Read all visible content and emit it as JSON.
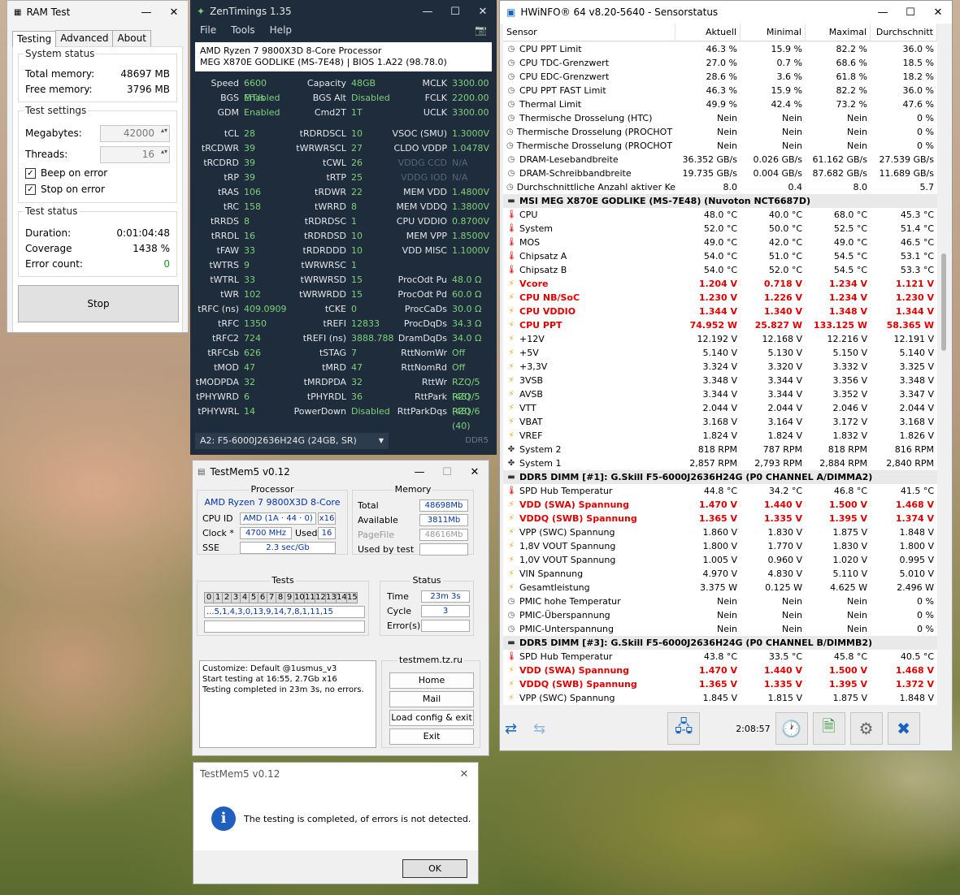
{
  "ramtest": {
    "title": "RAM Test",
    "tabs": [
      "Testing",
      "Advanced",
      "About"
    ],
    "system_status": {
      "label": "System status",
      "total_label": "Total memory:",
      "total": "48697 MB",
      "free_label": "Free memory:",
      "free": "3796 MB"
    },
    "settings": {
      "label": "Test settings",
      "mb_label": "Megabytes:",
      "mb": "42000",
      "threads_label": "Threads:",
      "threads": "16",
      "beep": "Beep on error",
      "stop": "Stop on error"
    },
    "test_status": {
      "label": "Test status",
      "duration_label": "Duration:",
      "duration": "0:01:04:48",
      "coverage_label": "Coverage",
      "coverage": "1438 %",
      "errors_label": "Error count:",
      "errors": "0"
    },
    "stop_button": "Stop"
  },
  "zen": {
    "title": "ZenTimings 1.35",
    "menu": [
      "File",
      "Tools",
      "Help"
    ],
    "cpu": "AMD Ryzen 7 9800X3D 8-Core Processor",
    "board": "MEG X870E GODLIKE (MS-7E48) | BIOS 1.A22 (98.78.0)",
    "header": [
      [
        "Speed",
        "6600 MT/s",
        "Capacity",
        "48GB",
        "MCLK",
        "3300.00"
      ],
      [
        "BGS",
        "Enabled",
        "BGS Alt",
        "Disabled",
        "FCLK",
        "2200.00"
      ],
      [
        "GDM",
        "Enabled",
        "Cmd2T",
        "1T",
        "UCLK",
        "3300.00"
      ]
    ],
    "timings": [
      [
        "tCL",
        "28",
        "tRDRDSCL",
        "10",
        "VSOC (SMU)",
        "1.3000V"
      ],
      [
        "tRCDWR",
        "39",
        "tWRWRSCL",
        "27",
        "CLDO VDDP",
        "1.0478V"
      ],
      [
        "tRCDRD",
        "39",
        "tCWL",
        "26",
        "VDDG CCD",
        "N/A"
      ],
      [
        "tRP",
        "39",
        "tRTP",
        "25",
        "VDDG IOD",
        "N/A"
      ],
      [
        "tRAS",
        "106",
        "tRDWR",
        "22",
        "MEM VDD",
        "1.4800V"
      ],
      [
        "tRC",
        "158",
        "tWRRD",
        "8",
        "MEM VDDQ",
        "1.3800V"
      ],
      [
        "tRRDS",
        "8",
        "tRDRDSC",
        "1",
        "CPU VDDIO",
        "0.8700V"
      ],
      [
        "tRRDL",
        "16",
        "tRDRDSD",
        "10",
        "MEM VPP",
        "1.8500V"
      ],
      [
        "tFAW",
        "33",
        "tRDRDDD",
        "10",
        "VDD MISC",
        "1.1000V"
      ],
      [
        "tWTRS",
        "9",
        "tWRWRSC",
        "1",
        "",
        ""
      ],
      [
        "tWTRL",
        "33",
        "tWRWRSD",
        "15",
        "ProcOdt Pu",
        "48.0 Ω"
      ],
      [
        "tWR",
        "102",
        "tWRWRDD",
        "15",
        "ProcOdt Pd",
        "60.0 Ω"
      ],
      [
        "tRFC (ns)",
        "409.0909",
        "tCKE",
        "0",
        "ProcCaDs",
        "30.0 Ω"
      ],
      [
        "tRFC",
        "1350",
        "tREFI",
        "12833",
        "ProcDqDs",
        "34.3 Ω"
      ],
      [
        "tRFC2",
        "724",
        "tREFI (ns)",
        "3888.788",
        "DramDqDs",
        "34.0 Ω"
      ],
      [
        "tRFCsb",
        "626",
        "tSTAG",
        "7",
        "RttNomWr",
        "Off"
      ],
      [
        "tMOD",
        "47",
        "tMRD",
        "47",
        "RttNomRd",
        "Off"
      ],
      [
        "tMODPDA",
        "32",
        "tMRDPDA",
        "32",
        "RttWr",
        "RZQ/5 (48)"
      ],
      [
        "tPHYWRD",
        "6",
        "tPHYRDL",
        "36",
        "RttPark",
        "RZQ/5 (48)"
      ],
      [
        "tPHYWRL",
        "14",
        "PowerDown",
        "Disabled",
        "RttParkDqs",
        "RZQ/6 (40)"
      ]
    ],
    "dimm": "A2: F5-6000J2636H24G (24GB, SR)",
    "ddr": "DDR5"
  },
  "hw": {
    "title": "HWiNFO® 64 v8.20-5640 - Sensorstatus",
    "cols": [
      "Sensor",
      "Aktuell",
      "Minimal",
      "Maximal",
      "Durchschnitt"
    ],
    "rows": [
      [
        "clk",
        "CPU PPT Limit",
        "46.3 %",
        "15.9 %",
        "82.2 %",
        "36.0 %",
        ""
      ],
      [
        "clk",
        "CPU TDC-Grenzwert",
        "27.0 %",
        "0.7 %",
        "68.6 %",
        "18.5 %",
        ""
      ],
      [
        "clk",
        "CPU EDC-Grenzwert",
        "28.6 %",
        "3.6 %",
        "61.8 %",
        "18.2 %",
        ""
      ],
      [
        "clk",
        "CPU PPT FAST Limit",
        "46.3 %",
        "15.9 %",
        "82.2 %",
        "36.0 %",
        ""
      ],
      [
        "clk",
        "Thermal Limit",
        "49.9 %",
        "42.4 %",
        "73.2 %",
        "47.6 %",
        ""
      ],
      [
        "clk",
        "Thermische Drosselung (HTC)",
        "Nein",
        "Nein",
        "Nein",
        "0 %",
        ""
      ],
      [
        "clk",
        "Thermische Drosselung (PROCHOT C...",
        "Nein",
        "Nein",
        "Nein",
        "0 %",
        ""
      ],
      [
        "clk",
        "Thermische Drosselung (PROCHOT EXT)",
        "Nein",
        "Nein",
        "Nein",
        "0 %",
        ""
      ],
      [
        "clk",
        "DRAM-Lesebandbreite",
        "36.352 GB/s",
        "0.026 GB/s",
        "61.162 GB/s",
        "27.539 GB/s",
        ""
      ],
      [
        "clk",
        "DRAM-Schreibbandbreite",
        "19.735 GB/s",
        "0.004 GB/s",
        "87.682 GB/s",
        "11.689 GB/s",
        ""
      ],
      [
        "clk",
        "Durchschnittliche Anzahl aktiver Kerne",
        "8.0",
        "0.4",
        "8.0",
        "5.7",
        ""
      ],
      [
        "chip",
        "MSI MEG X870E GODLIKE (MS-7E48) (Nuvoton NCT6687D)",
        "",
        "",
        "",
        "",
        "sec"
      ],
      [
        "th",
        "CPU",
        "48.0 °C",
        "40.0 °C",
        "68.0 °C",
        "45.3 °C",
        ""
      ],
      [
        "th",
        "System",
        "52.0 °C",
        "50.0 °C",
        "52.5 °C",
        "51.4 °C",
        ""
      ],
      [
        "th",
        "MOS",
        "49.0 °C",
        "42.0 °C",
        "49.0 °C",
        "46.5 °C",
        ""
      ],
      [
        "th",
        "Chipsatz A",
        "54.0 °C",
        "51.0 °C",
        "54.5 °C",
        "53.1 °C",
        ""
      ],
      [
        "th",
        "Chipsatz B",
        "54.0 °C",
        "52.0 °C",
        "54.5 °C",
        "53.3 °C",
        ""
      ],
      [
        "bolt",
        "Vcore",
        "1.204 V",
        "0.718 V",
        "1.234 V",
        "1.121 V",
        "red"
      ],
      [
        "bolt",
        "CPU NB/SoC",
        "1.230 V",
        "1.226 V",
        "1.234 V",
        "1.230 V",
        "red"
      ],
      [
        "bolt",
        "CPU VDDIO",
        "1.344 V",
        "1.340 V",
        "1.348 V",
        "1.344 V",
        "red"
      ],
      [
        "bolt",
        "CPU PPT",
        "74.952 W",
        "25.827 W",
        "133.125 W",
        "58.365 W",
        "red"
      ],
      [
        "bolt",
        "+12V",
        "12.192 V",
        "12.168 V",
        "12.216 V",
        "12.191 V",
        ""
      ],
      [
        "bolt",
        "+5V",
        "5.140 V",
        "5.130 V",
        "5.150 V",
        "5.140 V",
        ""
      ],
      [
        "bolt",
        "+3,3V",
        "3.324 V",
        "3.320 V",
        "3.332 V",
        "3.325 V",
        ""
      ],
      [
        "bolt",
        "3VSB",
        "3.348 V",
        "3.344 V",
        "3.356 V",
        "3.348 V",
        ""
      ],
      [
        "bolt",
        "AVSB",
        "3.344 V",
        "3.344 V",
        "3.352 V",
        "3.347 V",
        ""
      ],
      [
        "bolt",
        "VTT",
        "2.044 V",
        "2.044 V",
        "2.046 V",
        "2.044 V",
        ""
      ],
      [
        "bolt",
        "VBAT",
        "3.168 V",
        "3.164 V",
        "3.172 V",
        "3.168 V",
        ""
      ],
      [
        "bolt",
        "VREF",
        "1.824 V",
        "1.824 V",
        "1.832 V",
        "1.826 V",
        ""
      ],
      [
        "fan",
        "System 2",
        "818 RPM",
        "787 RPM",
        "818 RPM",
        "816 RPM",
        ""
      ],
      [
        "fan",
        "System 1",
        "2,857 RPM",
        "2,793 RPM",
        "2,884 RPM",
        "2,840 RPM",
        ""
      ],
      [
        "chip",
        "DDR5 DIMM [#1]: G.Skill F5-6000J2636H24G (P0 CHANNEL A/DIMMA2)",
        "",
        "",
        "",
        "",
        "sec"
      ],
      [
        "th",
        "SPD Hub Temperatur",
        "44.8 °C",
        "34.2 °C",
        "46.8 °C",
        "41.5 °C",
        ""
      ],
      [
        "bolt",
        "VDD (SWA) Spannung",
        "1.470 V",
        "1.440 V",
        "1.500 V",
        "1.468 V",
        "red"
      ],
      [
        "bolt",
        "VDDQ (SWB) Spannung",
        "1.365 V",
        "1.335 V",
        "1.395 V",
        "1.374 V",
        "red"
      ],
      [
        "bolt",
        "VPP (SWC) Spannung",
        "1.860 V",
        "1.830 V",
        "1.875 V",
        "1.848 V",
        ""
      ],
      [
        "bolt",
        "1,8V VOUT Spannung",
        "1.800 V",
        "1.770 V",
        "1.830 V",
        "1.800 V",
        ""
      ],
      [
        "bolt",
        "1,0V VOUT Spannung",
        "1.005 V",
        "0.960 V",
        "1.020 V",
        "0.995 V",
        ""
      ],
      [
        "bolt",
        "VIN Spannung",
        "4.970 V",
        "4.830 V",
        "5.110 V",
        "5.010 V",
        ""
      ],
      [
        "bolt",
        "Gesamtleistung",
        "3.375 W",
        "0.125 W",
        "4.625 W",
        "2.496 W",
        ""
      ],
      [
        "clk",
        "PMIC hohe Temperatur",
        "Nein",
        "Nein",
        "Nein",
        "0 %",
        ""
      ],
      [
        "clk",
        "PMIC-Überspannung",
        "Nein",
        "Nein",
        "Nein",
        "0 %",
        ""
      ],
      [
        "clk",
        "PMIC-Unterspannung",
        "Nein",
        "Nein",
        "Nein",
        "0 %",
        ""
      ],
      [
        "chip",
        "DDR5 DIMM [#3]: G.Skill F5-6000J2636H24G (P0 CHANNEL B/DIMMB2)",
        "",
        "",
        "",
        "",
        "sec"
      ],
      [
        "th",
        "SPD Hub Temperatur",
        "43.8 °C",
        "33.5 °C",
        "45.8 °C",
        "40.5 °C",
        ""
      ],
      [
        "bolt",
        "VDD (SWA) Spannung",
        "1.470 V",
        "1.440 V",
        "1.500 V",
        "1.468 V",
        "red"
      ],
      [
        "bolt",
        "VDDQ (SWB) Spannung",
        "1.365 V",
        "1.335 V",
        "1.395 V",
        "1.372 V",
        "red"
      ],
      [
        "bolt",
        "VPP (SWC) Spannung",
        "1.845 V",
        "1.815 V",
        "1.875 V",
        "1.848 V",
        ""
      ]
    ],
    "clock": "2:08:57"
  },
  "tm": {
    "title": "TestMem5 v0.12",
    "proc": {
      "label": "Processor",
      "name": "AMD Ryzen 7 9800X3D 8-Core",
      "cpuid_label": "CPU ID",
      "cpuid": "AMD  (1A · 44 · 0)",
      "threads": "x16",
      "clock_label": "Clock *",
      "clock": "4700 MHz",
      "used_label": "Used",
      "used": "16",
      "sse_label": "SSE",
      "sse": "2.3 sec/Gb"
    },
    "mem": {
      "label": "Memory",
      "total_label": "Total",
      "total": "48698Mb",
      "avail_label": "Available",
      "avail": "3811Mb",
      "page_label": "PageFile",
      "page": "48616Mb",
      "usedby_label": "Used by test",
      "usedby": ""
    },
    "tests": {
      "label": "Tests",
      "cells": [
        "0",
        "1",
        "2",
        "3",
        "4",
        "5",
        "6",
        "7",
        "8",
        "9",
        "10",
        "11",
        "12",
        "13",
        "14",
        "15"
      ],
      "seq": "...5,1,4,3,0,13,9,14,7,8,1,11,15"
    },
    "status": {
      "label": "Status",
      "time_label": "Time",
      "time": "23m 3s",
      "cycle_label": "Cycle",
      "cycle": "3",
      "err_label": "Error(s)",
      "err": ""
    },
    "log": [
      "Customize: Default @1usmus_v3",
      "Start testing at 16:55, 2.7Gb x16",
      "Testing completed in 23m 3s, no errors."
    ],
    "site": "testmem.tz.ru",
    "buttons": [
      "Home",
      "Mail",
      "Load config & exit",
      "Exit"
    ]
  },
  "dlg": {
    "title": "TestMem5 v0.12",
    "message": "The testing is completed, of errors is not detected.",
    "ok": "OK"
  }
}
